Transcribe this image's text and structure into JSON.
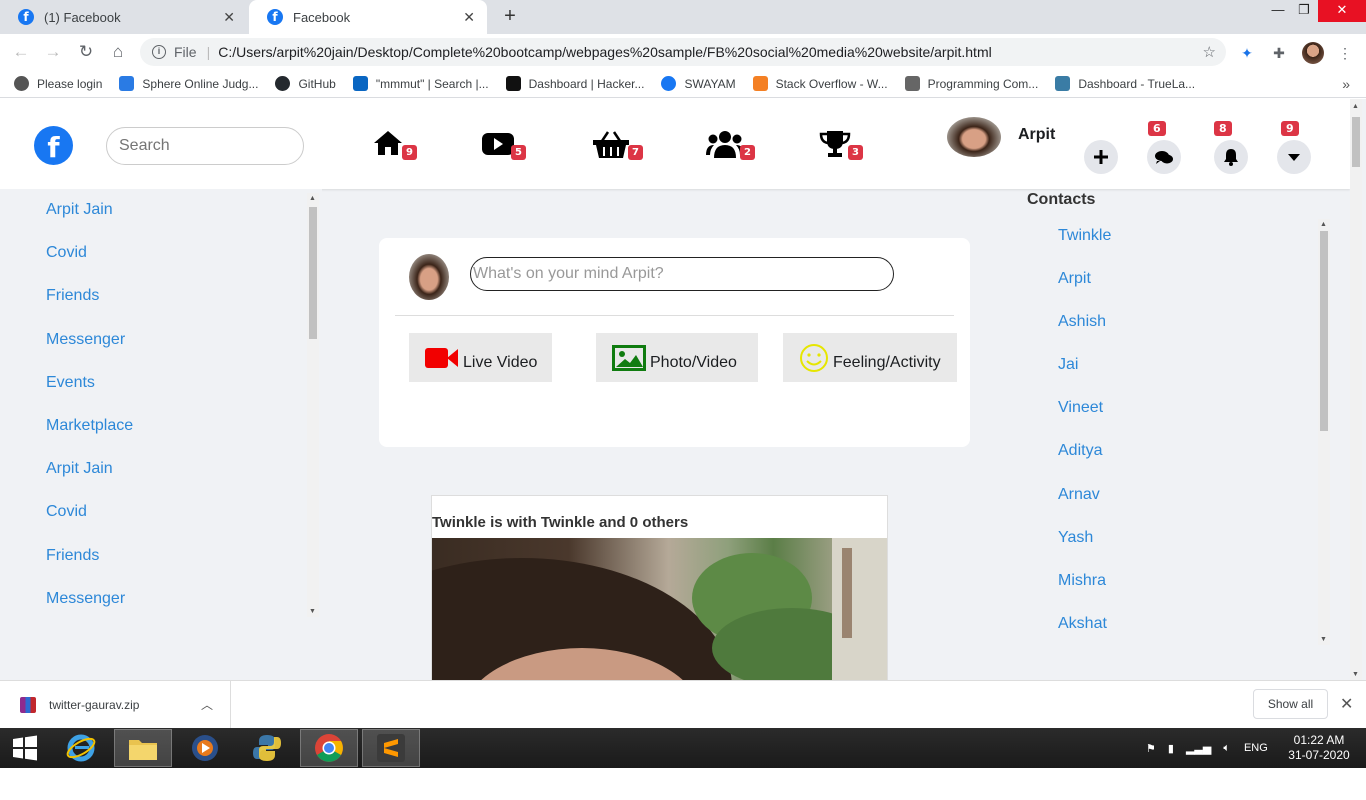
{
  "browser": {
    "tabs": [
      {
        "title": "(1) Facebook",
        "active": false
      },
      {
        "title": "Facebook",
        "active": true
      }
    ],
    "address": {
      "scheme": "File",
      "url": "C:/Users/arpit%20jain/Desktop/Complete%20bootcamp/webpages%20sample/FB%20social%20media%20website/arpit.html"
    },
    "bookmarks": [
      {
        "label": "Please login",
        "color": "#555555"
      },
      {
        "label": "Sphere Online Judg...",
        "color": "#2a7be4"
      },
      {
        "label": "GitHub",
        "color": "#24292e"
      },
      {
        "label": "\"mmmut\" | Search |...",
        "color": "#0a66c2"
      },
      {
        "label": "Dashboard | Hacker...",
        "color": "#1ba94c"
      },
      {
        "label": "SWAYAM",
        "color": "#1877f2"
      },
      {
        "label": "Stack Overflow - W...",
        "color": "#f48024"
      },
      {
        "label": "Programming Com...",
        "color": "#666666"
      },
      {
        "label": "Dashboard - TrueLa...",
        "color": "#3a7ca5"
      }
    ]
  },
  "fb": {
    "search_placeholder": "Search",
    "nav_badges": {
      "home": "9",
      "video": "5",
      "market": "7",
      "groups": "2",
      "gaming": "3"
    },
    "user_name": "Arpit",
    "action_badges": {
      "messages": "6",
      "notifications": "8",
      "menu": "9"
    },
    "left_menu": [
      "Arpit Jain",
      "Covid",
      "Friends",
      "Messenger",
      "Events",
      "Marketplace",
      "Arpit Jain",
      "Covid",
      "Friends",
      "Messenger"
    ],
    "composer": {
      "placeholder": "What's on your mind Arpit?",
      "live": "Live Video",
      "photo": "Photo/Video",
      "feeling": "Feeling/Activity"
    },
    "post": {
      "title": "Twinkle is with Twinkle and 0 others"
    },
    "contacts_title": "Contacts",
    "contacts": [
      "Twinkle",
      "Arpit",
      "Ashish",
      "Jai",
      "Vineet",
      "Aditya",
      "Arnav",
      "Yash",
      "Mishra",
      "Akshat"
    ]
  },
  "downloads": {
    "file": "twitter-gaurav.zip",
    "show_all": "Show all"
  },
  "taskbar": {
    "lang": "ENG",
    "time": "01:22 AM",
    "date": "31-07-2020"
  },
  "colors": {
    "fb_blue": "#1877f2",
    "badge_red": "#dc3545",
    "link_blue": "#2d88d8"
  }
}
